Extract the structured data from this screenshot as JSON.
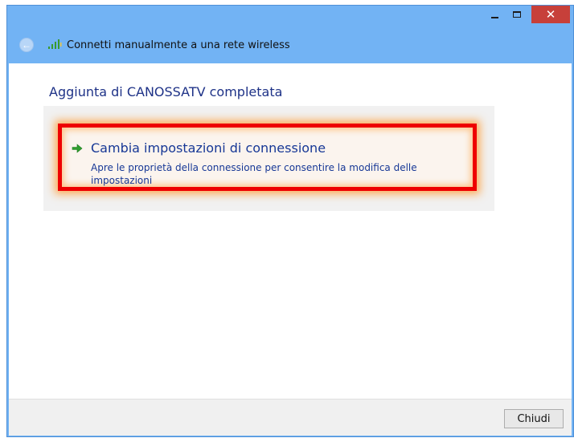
{
  "window": {
    "title": "Connetti manualmente a una rete wireless",
    "controls": {
      "close_glyph": "✕"
    },
    "back_glyph": "←"
  },
  "content": {
    "heading": "Aggiunta di CANOSSATV completata",
    "option": {
      "title": "Cambia impostazioni di connessione",
      "description": "Apre le proprietà della connessione per consentire la modifica delle impostazioni"
    }
  },
  "footer": {
    "close_label": "Chiudi"
  },
  "colors": {
    "titlebar": "#72b3f4",
    "highlight_border": "#ee0000",
    "link_text": "#173896",
    "heading_text": "#1e3287",
    "close_button_bg": "#c7403a"
  },
  "icons": {
    "back": "back-arrow-icon",
    "network": "wireless-signal-icon",
    "link_arrow": "green-arrow-icon"
  }
}
